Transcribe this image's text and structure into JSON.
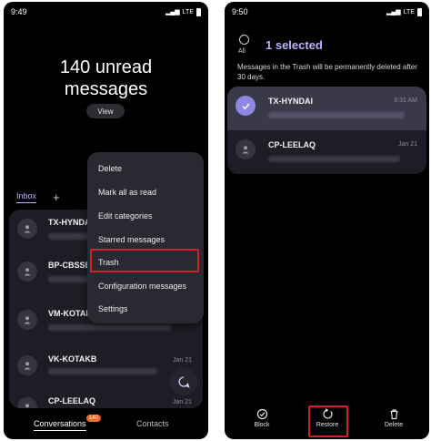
{
  "left": {
    "status": {
      "time": "9:49",
      "network": "LTE"
    },
    "header": {
      "unread_line1": "140 unread",
      "unread_line2": "messages",
      "view_label": "View"
    },
    "tabs": {
      "inbox": "Inbox",
      "add": "+"
    },
    "conversations": [
      {
        "name": "TX-HYNDAI",
        "date": ""
      },
      {
        "name": "BP-CBSSBI",
        "date": ""
      },
      {
        "name": "VM-KOTAKB",
        "date": ""
      },
      {
        "name": "VK-KOTAKB",
        "date": "Jan 21"
      },
      {
        "name": "CP-LEELAQ",
        "date": "Jan 21"
      }
    ],
    "menu": {
      "items": [
        "Delete",
        "Mark all as read",
        "Edit categories",
        "Starred messages",
        "Trash",
        "Configuration messages",
        "Settings"
      ],
      "highlighted": "Trash"
    },
    "nav": {
      "conversations": "Conversations",
      "badge": "140",
      "contacts": "Contacts"
    }
  },
  "right": {
    "status": {
      "time": "9:50",
      "network": "LTE"
    },
    "header": {
      "all_label": "All",
      "title": "1 selected"
    },
    "notice": "Messages in the Trash will be permanently deleted after 30 days.",
    "items": [
      {
        "name": "TX-HYNDAI",
        "time": "9:31 AM",
        "selected": true
      },
      {
        "name": "CP-LEELAQ",
        "time": "Jan 21",
        "selected": false
      }
    ],
    "actions": {
      "block": "Block",
      "restore": "Restore",
      "delete": "Delete",
      "highlighted": "Restore"
    }
  },
  "colors": {
    "accent": "#b8b2ff",
    "highlight": "#d4202a",
    "card": "#1e1d26",
    "badge": "#e96a2b"
  }
}
